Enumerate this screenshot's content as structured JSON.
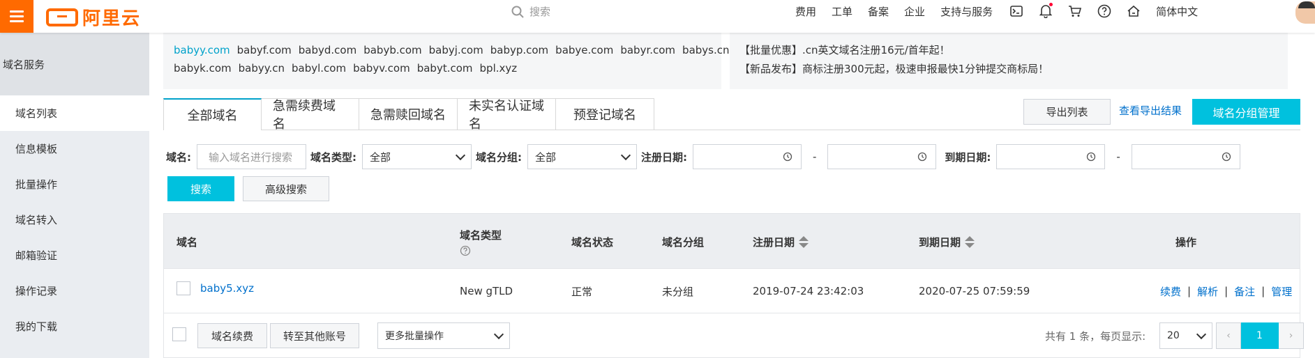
{
  "header": {
    "logo_text": "阿里云",
    "search_placeholder": "搜索",
    "nav": [
      "费用",
      "工单",
      "备案",
      "企业",
      "支持与服务"
    ],
    "lang": "简体中文",
    "icons": [
      "terminal-icon",
      "bell-icon",
      "cart-icon",
      "help-icon",
      "home-icon"
    ]
  },
  "sidebar": {
    "title": "域名服务",
    "items": [
      "域名列表",
      "信息模板",
      "批量操作",
      "域名转入",
      "邮箱验证",
      "操作记录",
      "我的下载"
    ]
  },
  "suggestions": {
    "row1": [
      "babyy.com",
      "babyf.com",
      "babyd.com",
      "babyb.com",
      "babyj.com",
      "babyp.com",
      "babye.com",
      "babyr.com",
      "babys.cn"
    ],
    "row2": [
      "babyk.com",
      "babyy.cn",
      "babyl.com",
      "babyv.com",
      "babyt.com",
      "bpl.xyz"
    ]
  },
  "promos": [
    "【批量优惠】.cn英文域名注册16元/首年起！",
    "【新品发布】商标注册300元起，极速申报最快1分钟提交商标局！"
  ],
  "tabs": [
    "全部域名",
    "急需续费域名",
    "急需赎回域名",
    "未实名认证域名",
    "预登记域名"
  ],
  "actions": {
    "export": "导出列表",
    "view_export": "查看导出结果",
    "group_manage": "域名分组管理"
  },
  "filters": {
    "domain_label": "域名:",
    "domain_placeholder": "输入域名进行搜索",
    "type_label": "域名类型:",
    "type_value": "全部",
    "group_label": "域名分组:",
    "group_value": "全部",
    "reg_date_label": "注册日期:",
    "exp_date_label": "到期日期:",
    "dash": "-",
    "search_btn": "搜索",
    "advanced_btn": "高级搜索"
  },
  "table": {
    "headers": {
      "domain": "域名",
      "type": "域名类型",
      "status": "域名状态",
      "group": "域名分组",
      "reg_date": "注册日期",
      "exp_date": "到期日期",
      "ops": "操作"
    },
    "row": {
      "domain": "baby5.xyz",
      "type": "New gTLD",
      "status": "正常",
      "group": "未分组",
      "reg_date": "2019-07-24 23:42:03",
      "exp_date": "2020-07-25 07:59:59",
      "ops": [
        "续费",
        "解析",
        "备注",
        "管理"
      ],
      "sep": "|"
    }
  },
  "footer": {
    "renew_btn": "域名续费",
    "transfer_btn": "转至其他账号",
    "more_ops": "更多批量操作",
    "total_text": "共有 1 条，每页显示:",
    "page_size": "20",
    "prev": "‹",
    "current_page": "1",
    "next": "›"
  },
  "colors": {
    "brand": "#ff6a00",
    "primary": "#00c1de",
    "link": "#0070cc"
  }
}
